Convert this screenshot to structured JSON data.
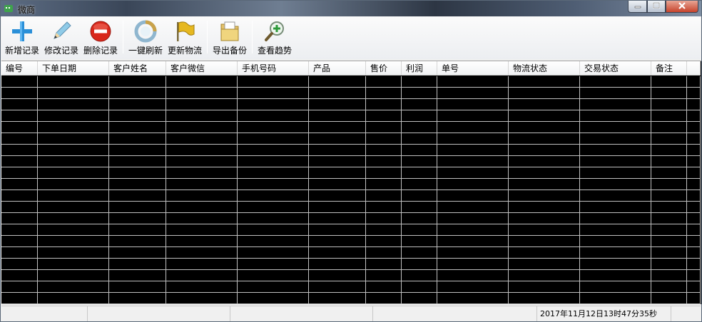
{
  "window": {
    "title": "微商",
    "controls": {
      "minimize": "minimize-icon",
      "maximize": "maximize-icon",
      "close": "close-icon"
    }
  },
  "toolbar": {
    "buttons": [
      {
        "label": "新增记录",
        "icon": "plus-icon"
      },
      {
        "label": "修改记录",
        "icon": "pencil-icon"
      },
      {
        "label": "删除记录",
        "icon": "minus-circle-icon"
      },
      {
        "label": "一键刷新",
        "icon": "refresh-icon"
      },
      {
        "label": "更新物流",
        "icon": "flag-icon"
      },
      {
        "label": "导出备份",
        "icon": "folder-icon"
      },
      {
        "label": "查看趋势",
        "icon": "zoom-in-icon"
      }
    ]
  },
  "grid": {
    "columns": [
      "编号",
      "下单日期",
      "客户姓名",
      "客户微信",
      "手机号码",
      "产品",
      "售价",
      "利润",
      "单号",
      "物流状态",
      "交易状态",
      "备注",
      ""
    ],
    "row_count": 20
  },
  "statusbar": {
    "panels": [
      "",
      "",
      "",
      "",
      "2017年11月12日13时47分35秒",
      ""
    ]
  },
  "colors": {
    "grid_background": "#000000",
    "grid_lines": "#c0c0c0",
    "accent_plus": "#2a8fd8",
    "delete_red": "#d8281c",
    "flag_yellow": "#e6b820"
  }
}
